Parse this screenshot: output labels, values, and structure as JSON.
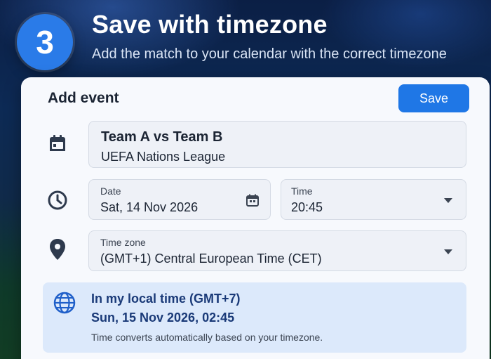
{
  "step": {
    "number": "3",
    "title": "Save with timezone",
    "subtitle": "Add the match to your calendar with the correct timezone"
  },
  "dialog": {
    "title": "Add event",
    "save_label": "Save"
  },
  "event": {
    "title": "Team A vs Team B",
    "subtitle": "UEFA Nations League"
  },
  "date": {
    "label": "Date",
    "value": "Sat, 14 Nov 2026"
  },
  "time": {
    "label": "Time",
    "value": "20:45"
  },
  "timezone": {
    "label": "Time zone",
    "value": "(GMT+1) Central European Time (CET)"
  },
  "local_time": {
    "heading": "In my local time (GMT+7)",
    "value": "Sun, 15 Nov 2026, 02:45",
    "note": "Time converts automatically based on your timezone."
  },
  "icons": {
    "event": "calendar-icon",
    "date_picker": "calendar-small-icon",
    "time": "clock-icon",
    "timezone": "location-pin-icon",
    "local_time": "globe-icon"
  },
  "colors": {
    "accent": "#1f77e6",
    "badge": "#2a7be8",
    "info_bg": "#dce9fb",
    "info_text": "#1a3a78"
  }
}
